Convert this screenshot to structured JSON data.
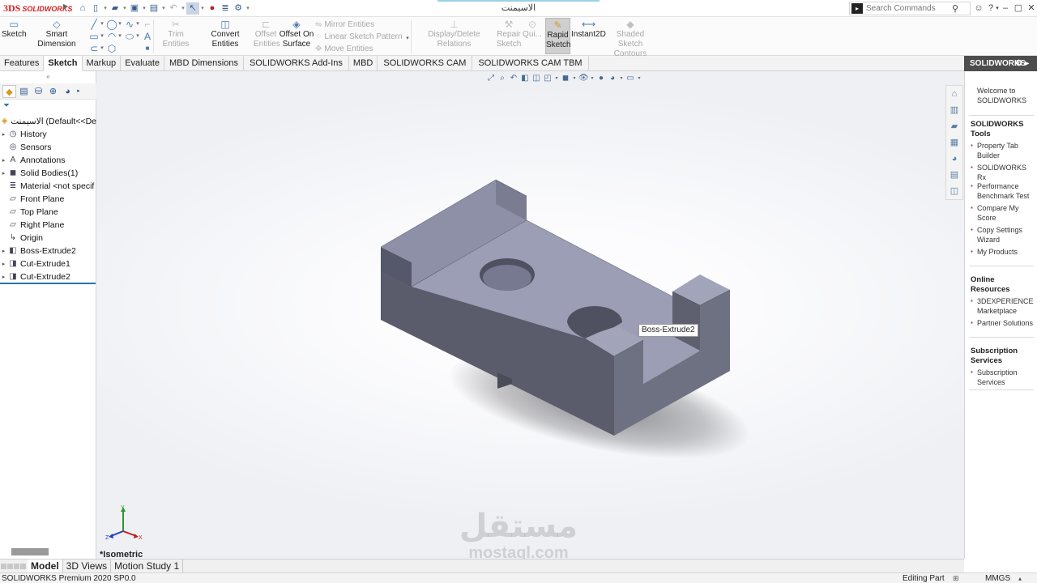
{
  "app": {
    "brand_ds": "3DS",
    "brand_name": "SOLIDWORKS",
    "document_title": "الاسيمنت"
  },
  "search": {
    "placeholder": "Search Commands"
  },
  "window": {
    "help": "?",
    "minimize": "–",
    "restore": "▢",
    "close": "✕"
  },
  "commands": {
    "sketch": "Sketch",
    "smart_dimension": "Smart Dimension",
    "trim_entities": "Trim Entities",
    "convert_entities": "Convert Entities",
    "offset_entities": [
      "Offset",
      "Entities"
    ],
    "offset_on_surface": [
      "Offset On",
      "Surface"
    ],
    "mirror_entities": "Mirror Entities",
    "linear_sketch_pattern": "Linear Sketch Pattern",
    "move_entities": "Move Entities",
    "display_delete_relations": "Display/Delete Relations",
    "repair_sketch": [
      "Repair",
      "Sketch"
    ],
    "quick_snaps": "Qui...",
    "rapid_sketch": [
      "Rapid",
      "Sketch"
    ],
    "instant2d": "Instant2D",
    "shaded_sketch_contours": [
      "Shaded Sketch",
      "Contours"
    ]
  },
  "tabs": [
    "Features",
    "Sketch",
    "Markup",
    "Evaluate",
    "MBD Dimensions",
    "SOLIDWORKS Add-Ins",
    "MBD",
    "SOLIDWORKS CAM",
    "SOLIDWORKS CAM TBM"
  ],
  "active_tab": "Sketch",
  "feature_tree": {
    "part_name": "الاسيمنت  (Default<<De",
    "items": [
      {
        "label": "History",
        "icon": "history-icon",
        "expandable": true
      },
      {
        "label": "Sensors",
        "icon": "sensors-icon",
        "expandable": false
      },
      {
        "label": "Annotations",
        "icon": "annotations-icon",
        "expandable": true
      },
      {
        "label": "Solid Bodies(1)",
        "icon": "solid-bodies-icon",
        "expandable": true
      },
      {
        "label": "Material <not specif",
        "icon": "material-icon",
        "expandable": false
      },
      {
        "label": "Front Plane",
        "icon": "plane-icon",
        "expandable": false
      },
      {
        "label": "Top Plane",
        "icon": "plane-icon",
        "expandable": false
      },
      {
        "label": "Right Plane",
        "icon": "plane-icon",
        "expandable": false
      },
      {
        "label": "Origin",
        "icon": "origin-icon",
        "expandable": false
      },
      {
        "label": "Boss-Extrude2",
        "icon": "boss-extrude-icon",
        "expandable": true
      },
      {
        "label": "Cut-Extrude1",
        "icon": "cut-extrude-icon",
        "expandable": true
      },
      {
        "label": "Cut-Extrude2",
        "icon": "cut-extrude-icon",
        "expandable": true
      }
    ]
  },
  "viewport": {
    "tooltip": "Boss-Extrude2",
    "view_name": "*Isometric",
    "part_color": "#9b9db5",
    "triad": {
      "y": "Y",
      "z": "Z",
      "x": "X"
    }
  },
  "watermark": {
    "arabic": "مستقل",
    "latin": "mostaql.com"
  },
  "task_pane": {
    "header": "SOLIDWORKS",
    "welcome": [
      "Welcome to",
      "SOLIDWORKS"
    ],
    "sections": [
      {
        "title": "SOLIDWORKS Tools",
        "items": [
          [
            "Property Tab",
            "Builder"
          ],
          [
            "SOLIDWORKS Rx"
          ],
          [
            "Performance",
            "Benchmark Test"
          ],
          [
            "Compare My",
            "Score"
          ],
          [
            "Copy Settings",
            "Wizard"
          ],
          [
            "My Products"
          ]
        ]
      },
      {
        "title": "Online Resources",
        "items": [
          [
            "3DEXPERIENCE",
            "Marketplace"
          ],
          [
            "Partner Solutions"
          ]
        ]
      },
      {
        "title": "Subscription Services",
        "items": [
          [
            "Subscription",
            "Services"
          ]
        ]
      }
    ]
  },
  "bottom_tabs": [
    "Model",
    "3D Views",
    "Motion Study 1"
  ],
  "active_bottom_tab": "Model",
  "status": {
    "product": "SOLIDWORKS Premium 2020 SP0.0",
    "mode": "Editing Part",
    "units": "MMGS"
  }
}
